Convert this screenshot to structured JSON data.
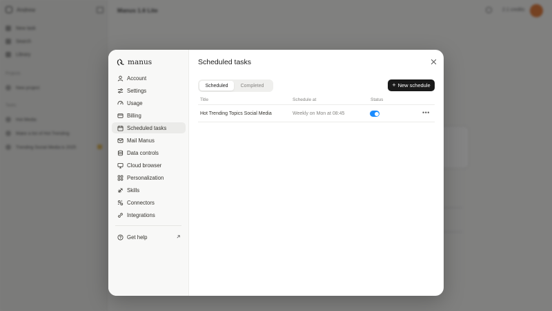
{
  "background": {
    "app_name": "Andrew",
    "header_title": "Manus 1.6 Lite",
    "credits": "2.1 credits",
    "nav": [
      "New task",
      "Search",
      "Library"
    ],
    "projects_label": "Projects",
    "project_item": "New project",
    "tasks_label": "Tasks",
    "tasks": [
      "Hot Media",
      "Make a list of Hot Trending",
      "Trending Social Media is 2025"
    ]
  },
  "modal": {
    "brand": "manus",
    "title": "Scheduled tasks",
    "nav": [
      {
        "label": "Account",
        "icon": "user-icon"
      },
      {
        "label": "Settings",
        "icon": "sliders-icon"
      },
      {
        "label": "Usage",
        "icon": "gauge-icon"
      },
      {
        "label": "Billing",
        "icon": "card-icon"
      },
      {
        "label": "Scheduled tasks",
        "icon": "calendar-icon",
        "active": true
      },
      {
        "label": "Mail Manus",
        "icon": "mail-icon"
      },
      {
        "label": "Data controls",
        "icon": "database-icon"
      },
      {
        "label": "Cloud browser",
        "icon": "monitor-icon"
      },
      {
        "label": "Personalization",
        "icon": "palette-icon"
      },
      {
        "label": "Skills",
        "icon": "puzzle-icon"
      },
      {
        "label": "Connectors",
        "icon": "plug-icon"
      },
      {
        "label": "Integrations",
        "icon": "link-icon"
      }
    ],
    "help": "Get help",
    "tabs": [
      "Scheduled",
      "Completed"
    ],
    "new_button": "New schedule",
    "columns": [
      "Title",
      "Schedule at",
      "Status"
    ],
    "rows": [
      {
        "title": "Hot Trending Topics Social Media",
        "schedule": "Weekly on Mon at 08:45",
        "status": true
      }
    ]
  },
  "colors": {
    "accent": "#1a8cff",
    "primary_button": "#1a1a1a"
  }
}
